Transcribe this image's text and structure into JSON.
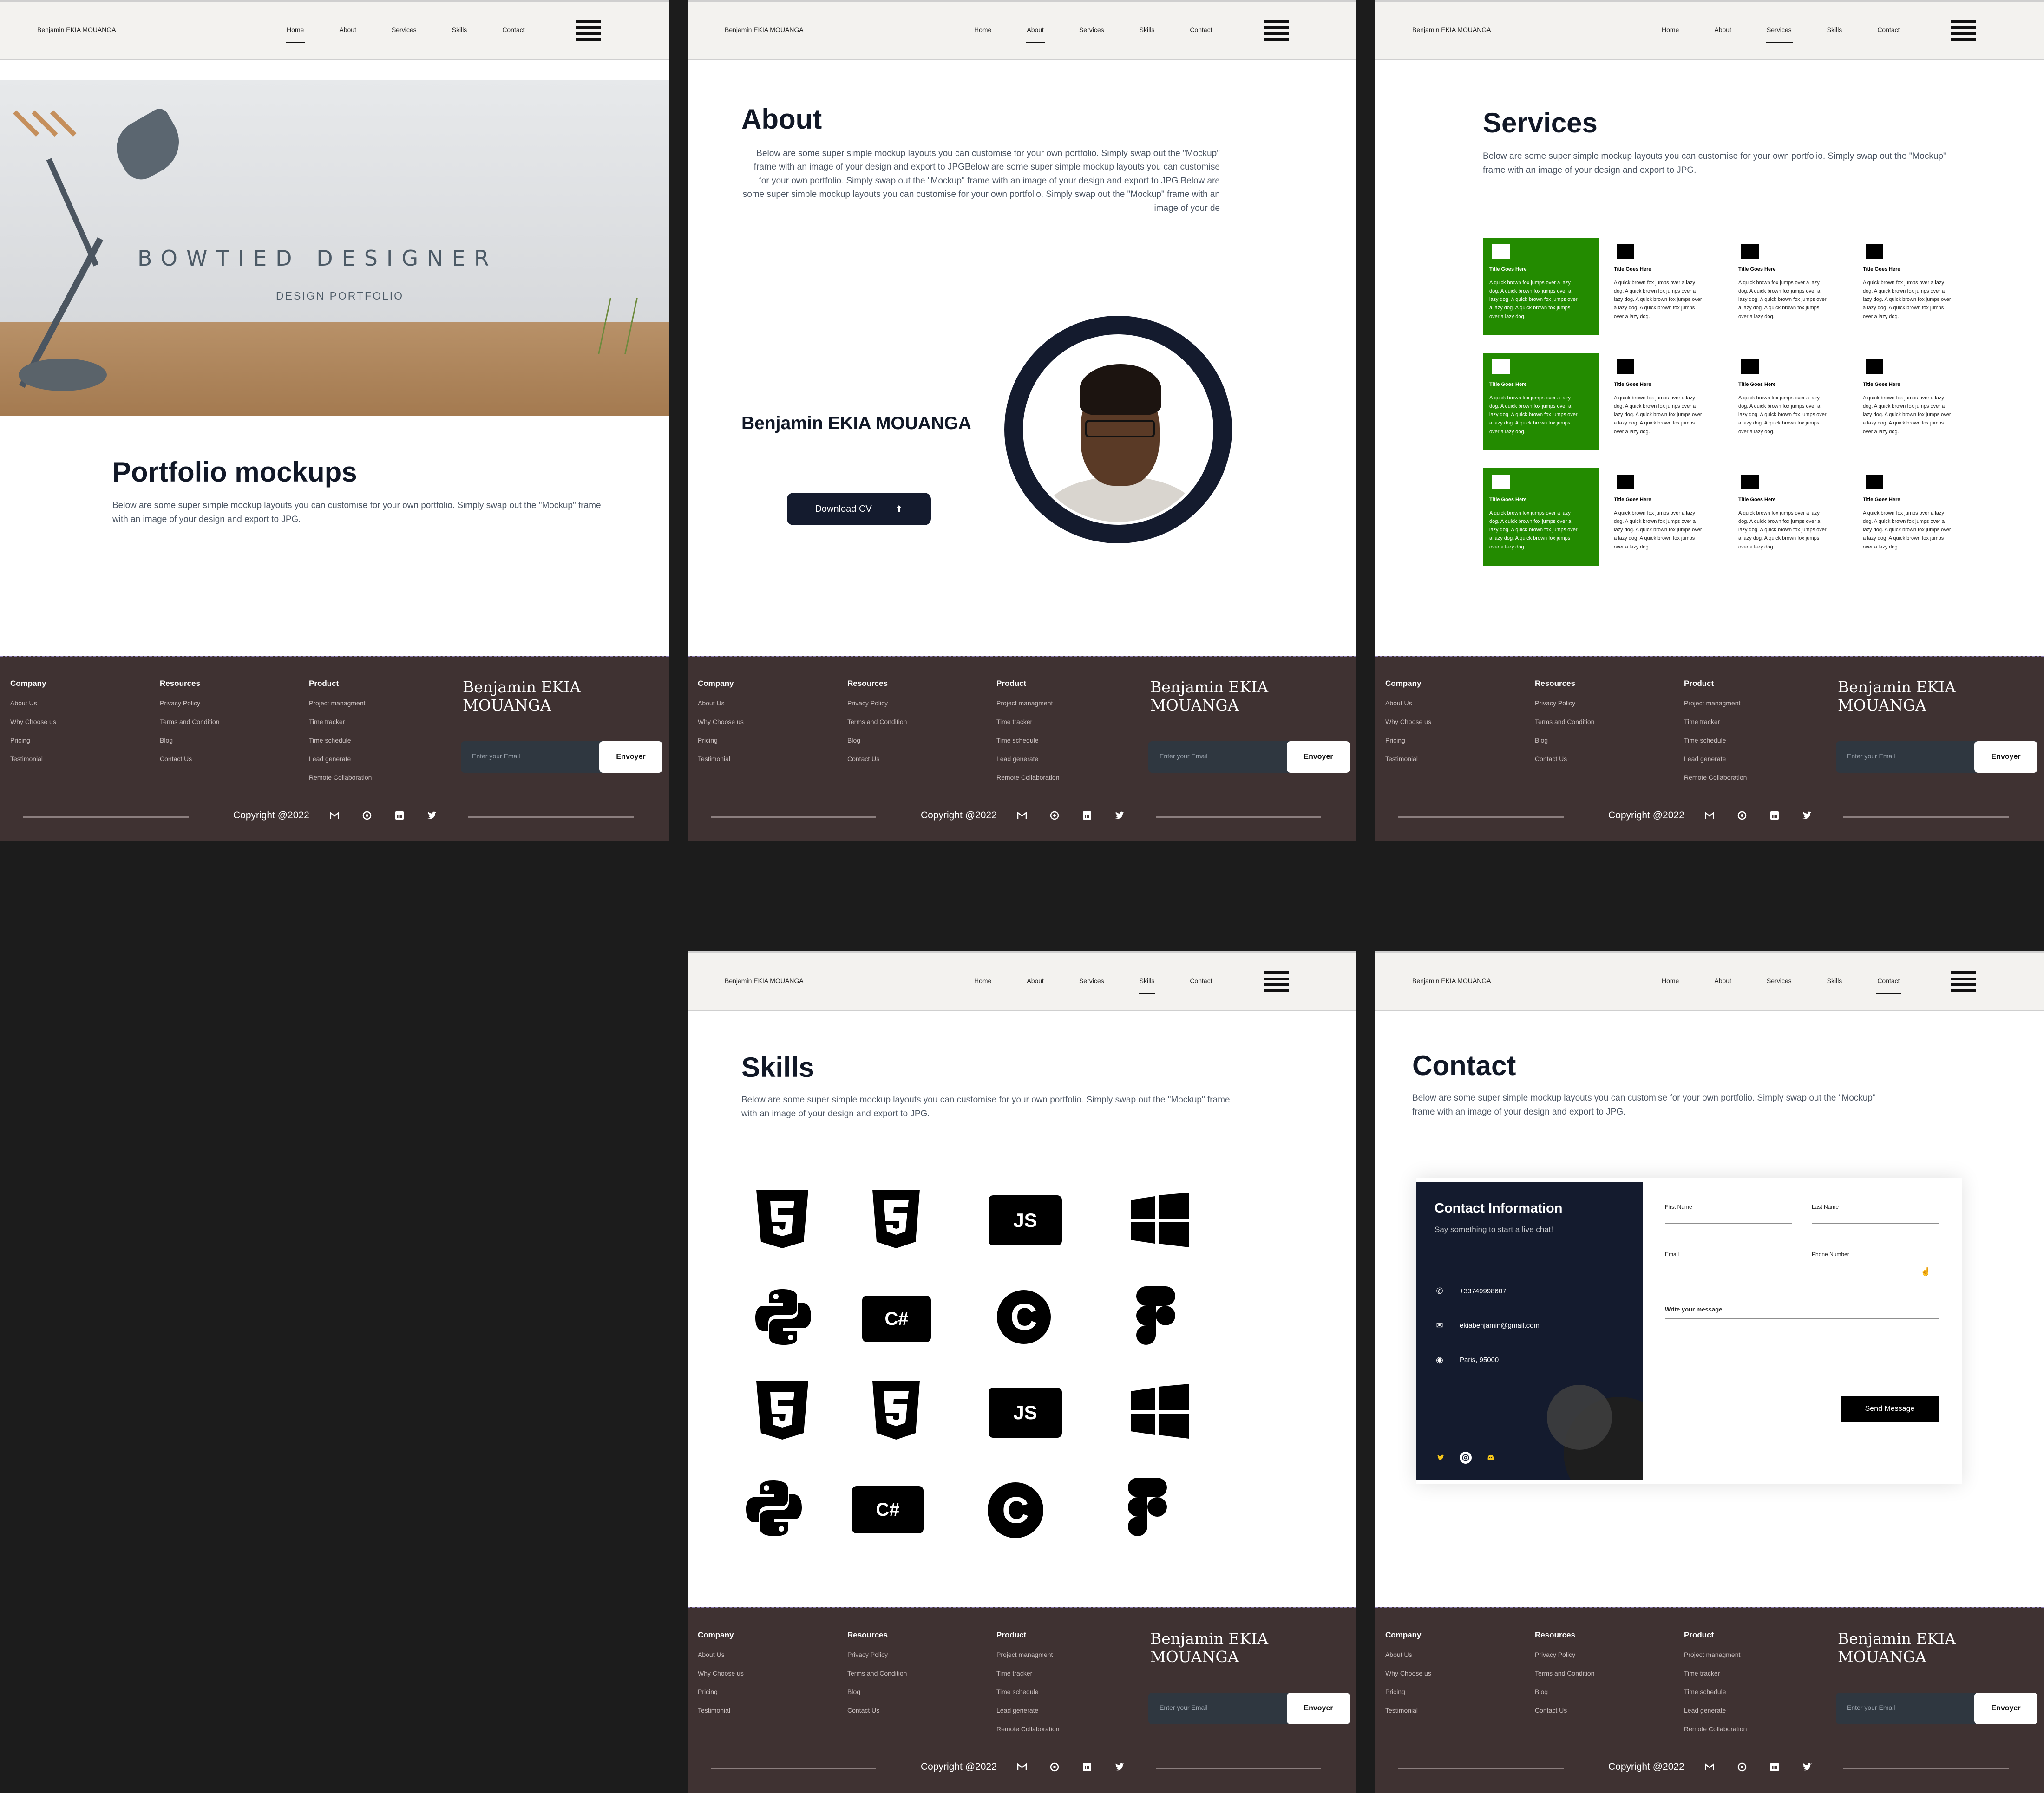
{
  "header": {
    "brand": "Benjamin EKIA MOUANGA",
    "nav": [
      "Home",
      "About",
      "Services",
      "Skills",
      "Contact"
    ]
  },
  "footer": {
    "company": {
      "title": "Company",
      "links": [
        "About Us",
        "Why Choose us",
        "Pricing",
        "Testimonial"
      ]
    },
    "resources": {
      "title": "Resources",
      "links": [
        "Privacy Policy",
        "Terms and Condition",
        "Blog",
        "Contact Us"
      ]
    },
    "product": {
      "title": "Product",
      "links": [
        "Project managment",
        "Time tracker",
        "Time schedule",
        "Lead generate",
        "Remote Collaboration"
      ]
    },
    "brand": "Benjamin EKIA MOUANGA",
    "email_placeholder": "Enter your Email",
    "submit": "Envoyer",
    "copyright": "Copyright @2022",
    "socials": [
      "gmail-icon",
      "github-icon",
      "linkedin-icon",
      "twitter-icon"
    ]
  },
  "home": {
    "hero_title": "BOWTIED DESIGNER",
    "hero_subtitle": "DESIGN PORTFOLIO",
    "heading": "Portfolio mockups",
    "text": "Below are some super simple mockup layouts you can customise for your own portfolio. Simply swap out the \"Mockup\" frame with an image of your design and export to JPG."
  },
  "about": {
    "heading": "About",
    "text": "Below are some super simple mockup layouts you can customise for your own portfolio. Simply swap out the \"Mockup\" frame with an image of your design and export to JPGBelow are some super simple mockup layouts you can customise for your own portfolio. Simply swap out the \"Mockup\" frame with an image of your design and export to JPG.Below are some super simple mockup layouts you can customise for your own portfolio. Simply swap out the \"Mockup\" frame with an image of your de",
    "name": "Benjamin EKIA MOUANGA",
    "download": "Download CV"
  },
  "services": {
    "heading": "Services",
    "text": "Below are some super simple mockup layouts you can customise for your own portfolio. Simply swap out the \"Mockup\" frame with an image of your design and export to JPG.",
    "card_title": "Title Goes Here",
    "card_text": "A quick brown fox jumps over a lazy dog. A quick brown fox jumps over a lazy dog. A quick brown fox jumps over a lazy dog. A quick brown fox jumps over a lazy dog.",
    "accent": "#238b00"
  },
  "skills": {
    "heading": "Skills",
    "text": "Below are some super simple mockup layouts you can customise for your own portfolio. Simply swap out the \"Mockup\" frame with an image of your design and export to JPG.",
    "icons": [
      "html5-icon",
      "css3-icon",
      "javascript-icon",
      "windows-icon",
      "python-icon",
      "csharp-icon",
      "c-icon",
      "figma-icon"
    ],
    "js_label": "JS",
    "cs_label": "C#",
    "c_label": "C"
  },
  "contact": {
    "heading": "Contact",
    "text": "Below are some super simple mockup layouts you can customise for your own portfolio. Simply swap out the \"Mockup\" frame with an image of your design and export to JPG.",
    "info_title": "Contact Information",
    "info_sub": "Say something to start a live chat!",
    "phone": "+33749998607",
    "email": "ekiabenjamin@gmail.com",
    "address": "Paris, 95000",
    "first_name": "First Name",
    "last_name": "Last Name",
    "email_label": "Email",
    "phone_label": "Phone Number",
    "message_placeholder": "Write your message..",
    "send": "Send Message"
  }
}
